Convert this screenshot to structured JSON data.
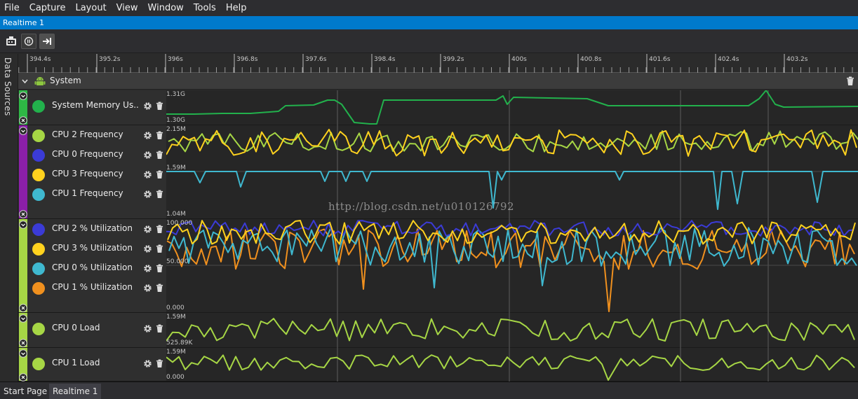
{
  "menu": [
    "File",
    "Capture",
    "Layout",
    "View",
    "Window",
    "Tools",
    "Help"
  ],
  "document_tab": "Realtime 1",
  "toolbar": {
    "capture_icon": "capture-icon",
    "pause_icon": "pause-icon",
    "follow_icon": "scroll-to-end-icon"
  },
  "side_panel": {
    "label": "Data Sources"
  },
  "ruler": {
    "ticks": [
      "394.4s",
      "395.2s",
      "396s",
      "396.8s",
      "397.6s",
      "398.4s",
      "399.2s",
      "400s",
      "400.8s",
      "401.6s",
      "402.4s",
      "403.2s"
    ]
  },
  "group": {
    "title": "System"
  },
  "tracks": [
    {
      "id": "memory",
      "color": "#2eb845",
      "series": [
        {
          "name": "System Memory Us...",
          "color": "#22b14c"
        }
      ],
      "axis": {
        "max": "1.31G",
        "min": "1.30G"
      }
    },
    {
      "id": "frequency",
      "color": "#8b1fa8",
      "series": [
        {
          "name": "CPU 2 Frequency",
          "color": "#a6d645"
        },
        {
          "name": "CPU 0 Frequency",
          "color": "#3b3bd6"
        },
        {
          "name": "CPU 3 Frequency",
          "color": "#ffd21e"
        },
        {
          "name": "CPU 1 Frequency",
          "color": "#3fb8cf"
        }
      ],
      "axis": {
        "max": "2.15M",
        "mid": "1.59M",
        "min": "1.04M"
      }
    },
    {
      "id": "utilization",
      "color": "#a6d645",
      "series": [
        {
          "name": "CPU 2 % Utilization",
          "color": "#3b3bd6"
        },
        {
          "name": "CPU 3 % Utilization",
          "color": "#ffd21e"
        },
        {
          "name": "CPU 0 % Utilization",
          "color": "#3fb8cf"
        },
        {
          "name": "CPU 1 % Utilization",
          "color": "#f0901e"
        }
      ],
      "axis": {
        "max": "100.000",
        "mid": "50.000",
        "min": "0.000"
      }
    },
    {
      "id": "cpu0load",
      "color": "#a6d645",
      "series": [
        {
          "name": "CPU 0 Load",
          "color": "#a6d645"
        }
      ],
      "axis": {
        "max": "1.59M",
        "min": "525.89K"
      }
    },
    {
      "id": "cpu1load",
      "color": "#a6d645",
      "series": [
        {
          "name": "CPU 1 Load",
          "color": "#a6d645"
        }
      ],
      "axis": {
        "max": "1.59M",
        "min": "0.000"
      }
    }
  ],
  "watermark": "http://blog.csdn.net/u010126792",
  "bottom_tabs": [
    "Start Page",
    "Realtime 1"
  ]
}
